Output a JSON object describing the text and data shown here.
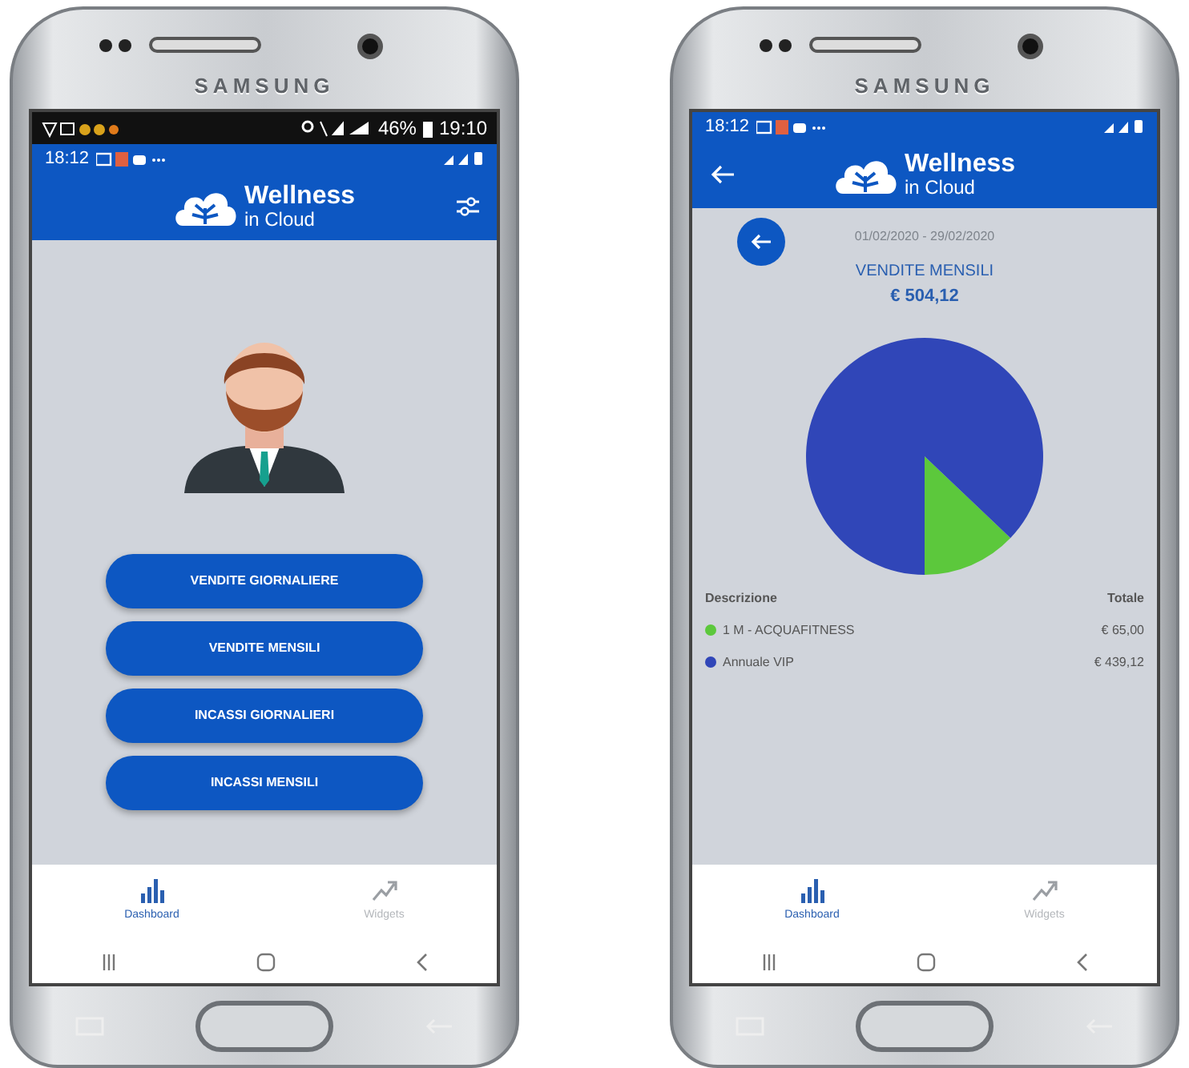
{
  "phones": [
    {
      "kind": "menu",
      "brand": "SAMSUNG",
      "device_status": {
        "battery": "46%",
        "time": "19:10"
      },
      "status": {
        "time": "18:12"
      },
      "header": {
        "logo_title": "Wellness",
        "logo_subtitle": "in Cloud",
        "back": false,
        "settings": true
      },
      "buttons": [
        "VENDITE GIORNALIERE",
        "VENDITE MENSILI",
        "INCASSI GIORNALIERI",
        "INCASSI MENSILI"
      ],
      "nav": [
        {
          "label": "Dashboard",
          "selected": true
        },
        {
          "label": "Widgets",
          "selected": false
        }
      ]
    },
    {
      "kind": "report",
      "brand": "SAMSUNG",
      "status": {
        "time": "18:12"
      },
      "header": {
        "logo_title": "Wellness",
        "logo_subtitle": "in Cloud",
        "back": true,
        "settings": false
      },
      "report": {
        "period": "01/02/2020 - 29/02/2020",
        "title": "VENDITE MENSILI",
        "amount": "€ 504,12",
        "chart_data": {
          "type": "pie",
          "categories": [
            "1 M - ACQUAFITNESS",
            "Annuale VIP"
          ],
          "values": [
            12.89,
            87.11
          ]
        },
        "table": {
          "columns": [
            "Descrizione",
            "Totale"
          ],
          "rows": [
            {
              "total": "€ 65,00",
              "color": "#5cc83c"
            },
            {
              "total": "€ 439,12",
              "color": "#3046b8"
            }
          ]
        }
      },
      "nav": [
        {
          "label": "Dashboard",
          "selected": true
        },
        {
          "label": "Widgets",
          "selected": false
        }
      ]
    }
  ]
}
